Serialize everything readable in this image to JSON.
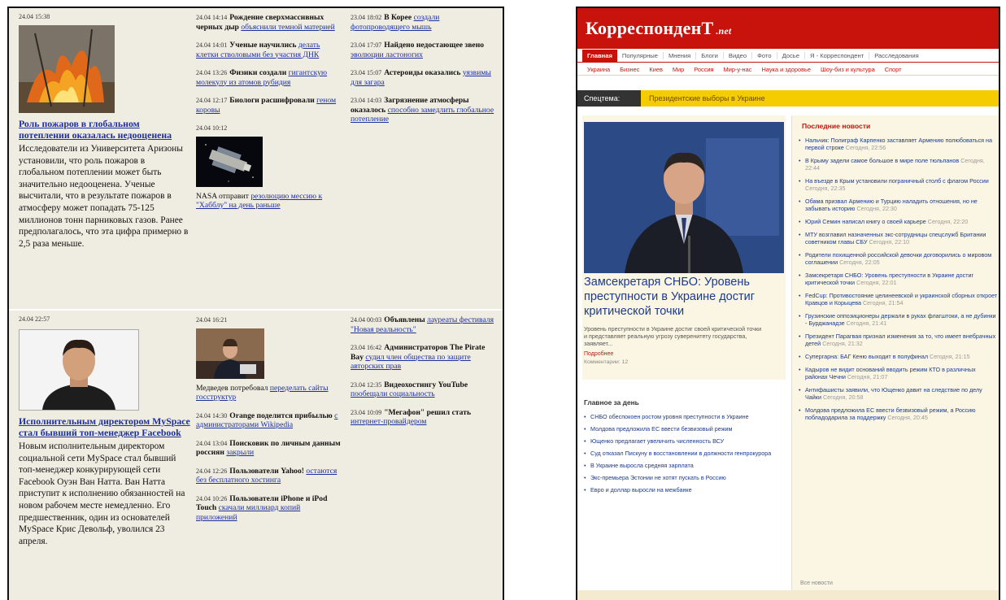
{
  "left": {
    "section1": {
      "col1": {
        "timestamp": "24.04 15:38",
        "headline": "Роль пожаров в глобальном потеплении оказалась недооценена",
        "lead": "Исследователи из Университета Аризоны установили, что роль пожаров в глобальном потеплении может быть значительно недооценена. Ученые высчитали, что в результате пожаров в атмосферу может попадать 75-125 миллионов тонн парниковых газов. Ранее предполагалось, что эта цифра примерно в 2,5 раза меньше."
      },
      "col2": [
        {
          "time": "24.04 14:14",
          "title": "Рождение сверхмассивных черных дыр",
          "link": "объяснили темной материей"
        },
        {
          "time": "24.04 14:01",
          "title": "Ученые научились",
          "link": "делать клетки стволовыми без участия ДНК"
        },
        {
          "time": "24.04 13:26",
          "title": "Физики создали",
          "link": "гигантскую молекулу из атомов рубидия"
        },
        {
          "time": "24.04 12:17",
          "title": "Биологи расшифровали",
          "link": "геном коровы"
        },
        {
          "time": "24.04 10:12",
          "title": "",
          "link": ""
        },
        {
          "time": "",
          "title": "NASA отправит",
          "link": "резолюцию  мессию к \"Хабблу\" на день раньше"
        }
      ],
      "col3": [
        {
          "time": "23.04 18:02",
          "title": "В Корее",
          "link": "создали фотопроводящего мышь"
        },
        {
          "time": "23.04 17:07",
          "title": "Найдено недостающее звено",
          "link": "эволюции ластоногих"
        },
        {
          "time": "23.04 15:07",
          "title": "Астероиды оказались",
          "link": "уязвимы для загара"
        },
        {
          "time": "23.04 14:03",
          "title": "Загрязнение атмосферы оказалось",
          "link": "способно замедлить глобальное потепление"
        }
      ]
    },
    "section2": {
      "col1": {
        "timestamp": "24.04 22:57",
        "headline": "Исполнительным директором MySpace стал бывший топ-менеджер Facebook",
        "lead": "Новым исполнительным директором социальной сети MySpace стал бывший топ-менеджер конкурирующей сети Facebook Оуэн Ван Натта. Ван Натта приступит к исполнению обязанностей на новом рабочем месте немедленно. Его предшественник, один из основателей MySpace Крис Девольф, уволился 23 апреля."
      },
      "col2": [
        {
          "time": "24.04 16:21",
          "title": "",
          "link": ""
        },
        {
          "time": "",
          "title": "Медведев потребовал",
          "link": "переделать сайты госструктур"
        },
        {
          "time": "24.04 14:30",
          "title": "Orange поделится прибылью",
          "link": "с администраторами Wikipedia"
        },
        {
          "time": "24.04 13:04",
          "title": "Поисковик по личным данным россиян",
          "link": "закрыли"
        },
        {
          "time": "24.04 12:26",
          "title": "Пользователи Yahoo!",
          "link": "остаются без бесплатного хостинга"
        },
        {
          "time": "24.04 10:26",
          "title": "Пользователи iPhone и iPod Touch",
          "link": "скачали миллиард копий приложений"
        }
      ],
      "col3": [
        {
          "time": "24.04 00:03",
          "title": "Объявлены",
          "link": "лауреаты фестиваля \"Новая реальность\""
        },
        {
          "time": "23.04 16:42",
          "title": "Администраторов The Pirate Bay",
          "link": "судил член общества по защите авторских прав"
        },
        {
          "time": "23.04 12:35",
          "title": "Видеохостингу YouTube",
          "link": "пообещали социальность"
        },
        {
          "time": "23.04 10:09",
          "title": "\"Мегафон\" решил стать",
          "link": "интернет-провайдером"
        }
      ]
    }
  },
  "right": {
    "logo_main": "КорреспонденТ",
    "logo_domain": ".net",
    "nav1": [
      "Главная",
      "Популярные",
      "Мнения",
      "Блоги",
      "Видео",
      "Фото",
      "Досье",
      "Я - Корреспондент",
      "Расследования"
    ],
    "nav2": [
      "Украина",
      "Бизнес",
      "Киев",
      "Мир",
      "Россия",
      "Мир-у-нас",
      "Наука и здоровье",
      "Шоу-биз и культура",
      "Спорт"
    ],
    "special_label": "Спецтема:",
    "special_text": "Президентские выборы в Украине",
    "feature_title": "Замсекретаря СНБО: Уровень преступности в Украине достиг критической точки",
    "feature_desc": "Уровень преступности в Украине достиг своей критической точки и представляет реальную угрозу суверенитету государства, заявляет...",
    "feature_more": "Подробнее",
    "feature_meta": "Комментарии: 12",
    "day_title": "Главное за день",
    "day_items": [
      "СНБО обеспокоен ростом уровня преступности в Украине",
      "Молдова предложила ЕС ввести безвизовый режим",
      "Ющенко предлагает увеличить численность ВСУ",
      "Суд отказал Пискуну в восстановлении в должности генпрокурора",
      "В Украине выросла средняя зарплата",
      "Экс-премьера Эстонии не хотят пускать в Россию",
      "Евро и доллар выросли на межбанке"
    ],
    "latest_title": "Последние новости",
    "latest_items": [
      {
        "text": "Нальчик: Полиграф Карпенко заставляет Армению полюбоваться на первой строке",
        "time": "Сегодня, 22:56"
      },
      {
        "text": "В Крыму задели самое большое в мире поле тюльпанов",
        "time": "Сегодня, 22:44"
      },
      {
        "text": "На въезде в Крым установили пограничный столб с флагом России",
        "time": "Сегодня, 22:35"
      },
      {
        "text": "Обама призвал Армению и Турцию наладить отношения, но не забывать историю",
        "time": "Сегодня, 22:30"
      },
      {
        "text": "Юрий Семин написал книгу о своей карьере",
        "time": "Сегодня, 22:20"
      },
      {
        "text": "МТУ возглавил назначенных экс-сотрудницы спецслужб Британии советником главы СБУ",
        "time": "Сегодня, 22:10"
      },
      {
        "text": "Родители похищенной российской девочки договорились о мировом соглашении",
        "time": "Сегодня, 22:05"
      },
      {
        "text": "Замсекретаря СНБО: Уровень преступности в Украине достиг критической точки",
        "time": "Сегодня, 22:01"
      },
      {
        "text": "FedCup: Противостояние целинеевской и украинской сборных откроет Кравцов и Корыцева",
        "time": "Сегодня, 21:54"
      },
      {
        "text": "Грузинские оппозиционеры держали в руках флагштоки, а не дубинки - Бурджанадзе",
        "time": "Сегодня, 21:41"
      },
      {
        "text": "Президент Парагвая признал изменения за то, что имеет внебрачных детей",
        "time": "Сегодня, 21:32"
      },
      {
        "text": "Супергарна: БАГ Кеню выходит в полуфинал",
        "time": "Сегодня, 21:15"
      },
      {
        "text": "Кадыров не видит оснований вводить режим КТО в различных районах Чечни",
        "time": "Сегодня, 21:07"
      },
      {
        "text": "Антифашисты заявили, что Ющенко давит на следствие по делу Чайки",
        "time": "Сегодня, 20:58"
      },
      {
        "text": "Молдова предложила ЕС ввести безвизовый режим, а Россию побладодарила за поддержку",
        "time": "Сегодня, 20:45"
      }
    ],
    "all_link": "Все новости"
  }
}
